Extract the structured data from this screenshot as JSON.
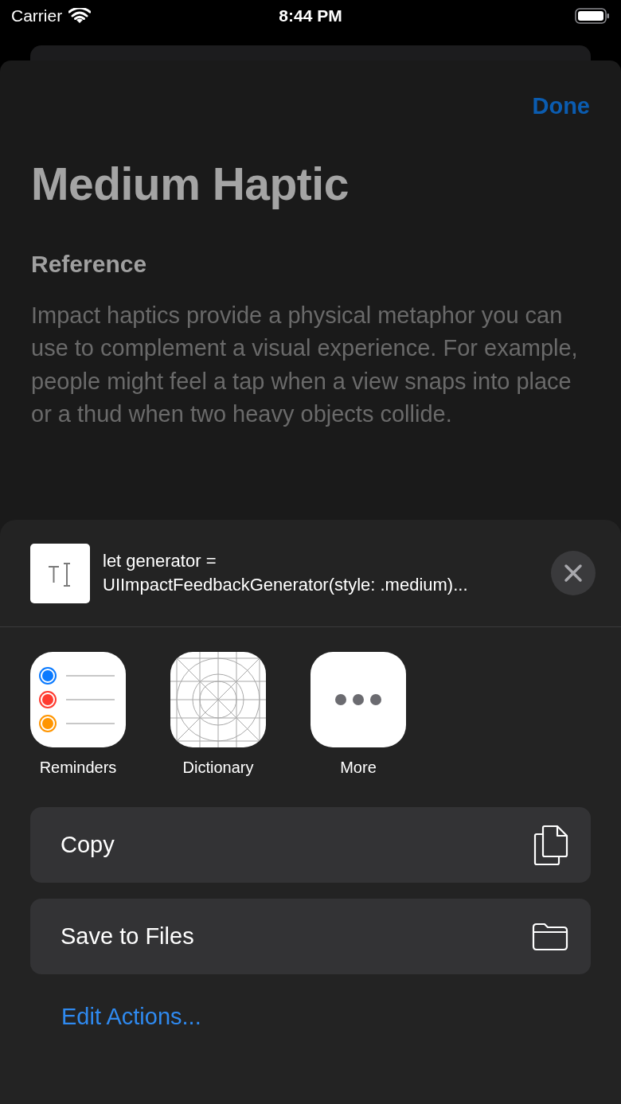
{
  "status_bar": {
    "carrier": "Carrier",
    "time": "8:44 PM"
  },
  "nav": {
    "done": "Done"
  },
  "title": "Medium Haptic",
  "section_heading": "Reference",
  "paragraph": "Impact haptics provide a physical metaphor you can use to complement a visual experience. For example, people might feel a tap when a view snaps into place or a thud when two heavy objects collide.",
  "share_sheet": {
    "preview_lines": [
      "let generator =",
      "UIImpactFeedbackGenerator(style: .medium)..."
    ],
    "apps": [
      {
        "label": "Reminders",
        "kind": "reminders"
      },
      {
        "label": "Dictionary",
        "kind": "dictionary"
      },
      {
        "label": "More",
        "kind": "more"
      }
    ],
    "actions": [
      {
        "label": "Copy",
        "kind": "copy"
      },
      {
        "label": "Save to Files",
        "kind": "files"
      }
    ],
    "edit_actions": "Edit Actions..."
  }
}
